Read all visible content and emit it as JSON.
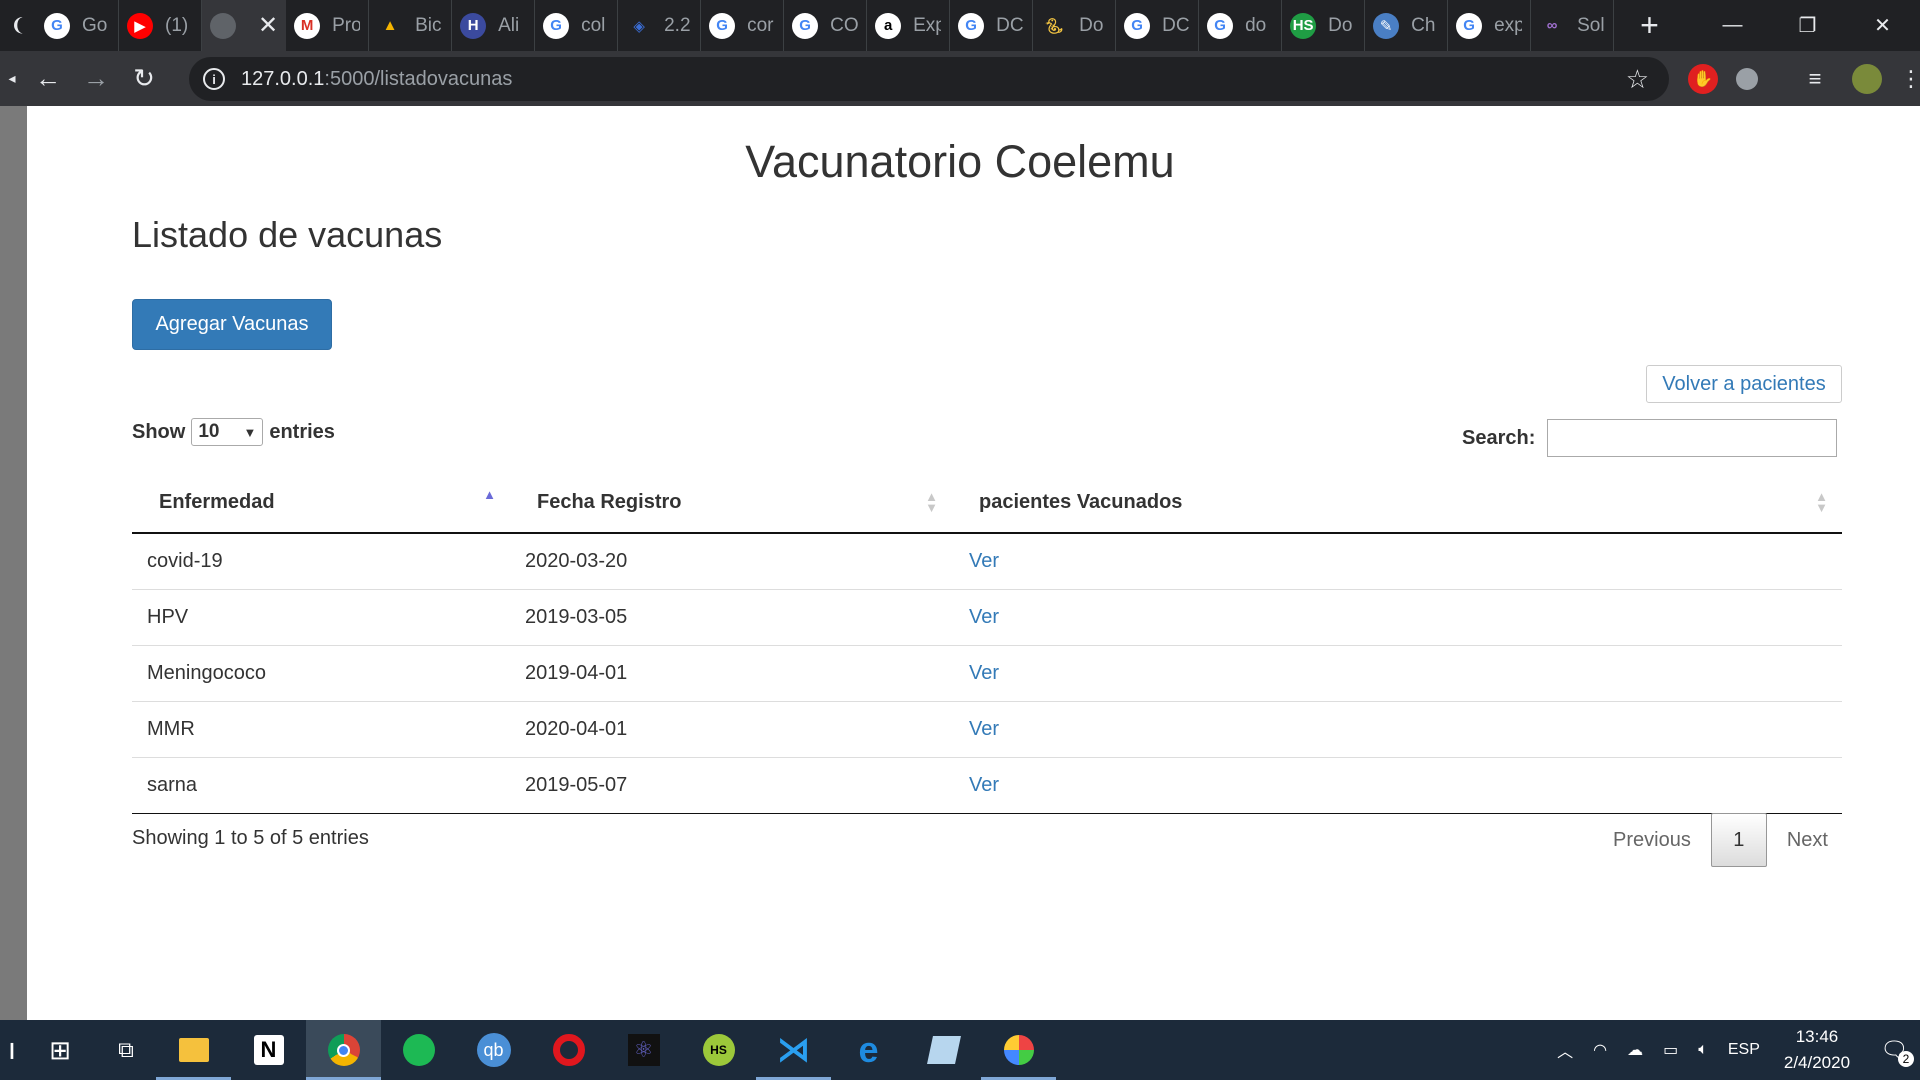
{
  "browser": {
    "tabs": [
      {
        "label": "Go",
        "icon": "google-icon"
      },
      {
        "label": "(1)",
        "icon": "youtube-icon"
      },
      {
        "label": "",
        "icon": "loading-icon",
        "active": true
      },
      {
        "label": "Pro",
        "icon": "gmail-icon"
      },
      {
        "label": "Bic",
        "icon": "drive-icon"
      },
      {
        "label": "Ali",
        "icon": "hcc-icon"
      },
      {
        "label": "col",
        "icon": "google-icon"
      },
      {
        "label": "2.2",
        "icon": "bluebird-icon"
      },
      {
        "label": "cor",
        "icon": "google-icon"
      },
      {
        "label": "CO",
        "icon": "google-icon"
      },
      {
        "label": "Exp",
        "icon": "a-icon"
      },
      {
        "label": "DC",
        "icon": "google-icon"
      },
      {
        "label": "Do",
        "icon": "python-icon"
      },
      {
        "label": "DC",
        "icon": "google-icon"
      },
      {
        "label": "do",
        "icon": "google-icon"
      },
      {
        "label": "Do",
        "icon": "hs-icon"
      },
      {
        "label": "Ch",
        "icon": "paint-icon"
      },
      {
        "label": "exp",
        "icon": "google-icon"
      },
      {
        "label": "Sol",
        "icon": "infinity-icon"
      }
    ],
    "url_host": "127.0.0.1",
    "url_rest": ":5000/listadovacunas"
  },
  "page": {
    "title": "Vacunatorio Coelemu",
    "section_title": "Listado de vacunas",
    "add_button": "Agregar Vacunas",
    "back_button": "Volver a pacientes",
    "show_label": "Show",
    "entries_value": "10",
    "entries_label": "entries",
    "search_label": "Search:",
    "search_value": "",
    "columns": [
      "Enfermedad",
      "Fecha Registro",
      "pacientes Vacunados"
    ],
    "rows": [
      {
        "enfermedad": "covid-19",
        "fecha": "2020-03-20",
        "link": "Ver"
      },
      {
        "enfermedad": "HPV",
        "fecha": "2019-03-05",
        "link": "Ver"
      },
      {
        "enfermedad": "Meningococo",
        "fecha": "2019-04-01",
        "link": "Ver"
      },
      {
        "enfermedad": "MMR",
        "fecha": "2020-04-01",
        "link": "Ver"
      },
      {
        "enfermedad": "sarna",
        "fecha": "2019-05-07",
        "link": "Ver"
      }
    ],
    "info": "Showing 1 to 5 of 5 entries",
    "pager": {
      "previous": "Previous",
      "current": "1",
      "next": "Next"
    }
  },
  "taskbar": {
    "language": "ESP",
    "time": "13:46",
    "date": "2/4/2020",
    "notifications": "2"
  },
  "colors": {
    "primary": "#337ab7",
    "link": "#337ab7",
    "chrome_dark": "#202124",
    "taskbar": "#1c2a3a"
  }
}
